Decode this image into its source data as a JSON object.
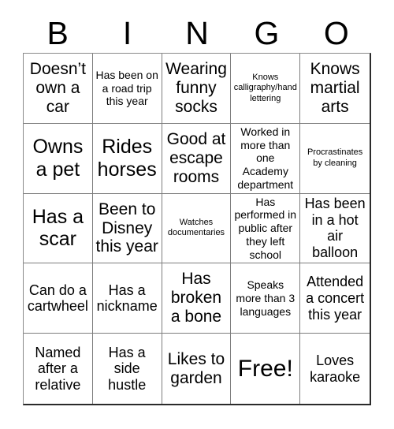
{
  "header": {
    "letters": [
      "B",
      "I",
      "N",
      "G",
      "O"
    ]
  },
  "grid": {
    "columns": 5,
    "rows": 5,
    "cells": [
      {
        "text": "Doesn’t own a car",
        "size": "lg"
      },
      {
        "text": "Has been on a road trip this year",
        "size": "sm"
      },
      {
        "text": "Wearing funny socks",
        "size": "lg"
      },
      {
        "text": "Knows calligraphy/hand lettering",
        "size": "xs"
      },
      {
        "text": "Knows martial arts",
        "size": "lg"
      },
      {
        "text": "Owns a pet",
        "size": "xl"
      },
      {
        "text": "Rides horses",
        "size": "xl"
      },
      {
        "text": "Good at escape rooms",
        "size": "lg"
      },
      {
        "text": "Worked in more than one Academy department",
        "size": "sm"
      },
      {
        "text": "Procrastinates by cleaning",
        "size": "xs"
      },
      {
        "text": "Has a scar",
        "size": "xl"
      },
      {
        "text": "Been to Disney this year",
        "size": "lg"
      },
      {
        "text": "Watches documentaries",
        "size": "xs"
      },
      {
        "text": "Has performed in public after they left school",
        "size": "sm"
      },
      {
        "text": "Has been in a hot air balloon",
        "size": "md"
      },
      {
        "text": "Can do a cartwheel",
        "size": "md"
      },
      {
        "text": "Has a nickname",
        "size": "md"
      },
      {
        "text": "Has broken a bone",
        "size": "lg"
      },
      {
        "text": "Speaks more than 3 languages",
        "size": "sm"
      },
      {
        "text": "Attended a concert this year",
        "size": "md"
      },
      {
        "text": "Named after a relative",
        "size": "md"
      },
      {
        "text": "Has a side hustle",
        "size": "md"
      },
      {
        "text": "Likes to garden",
        "size": "lg"
      },
      {
        "text": "Free!",
        "size": "free"
      },
      {
        "text": "Loves karaoke",
        "size": "md"
      }
    ]
  },
  "colors": {
    "background": "#ffffff",
    "text": "#000000",
    "grid_line": "#7d7d7d",
    "grid_outer": "#2b2b2b"
  }
}
